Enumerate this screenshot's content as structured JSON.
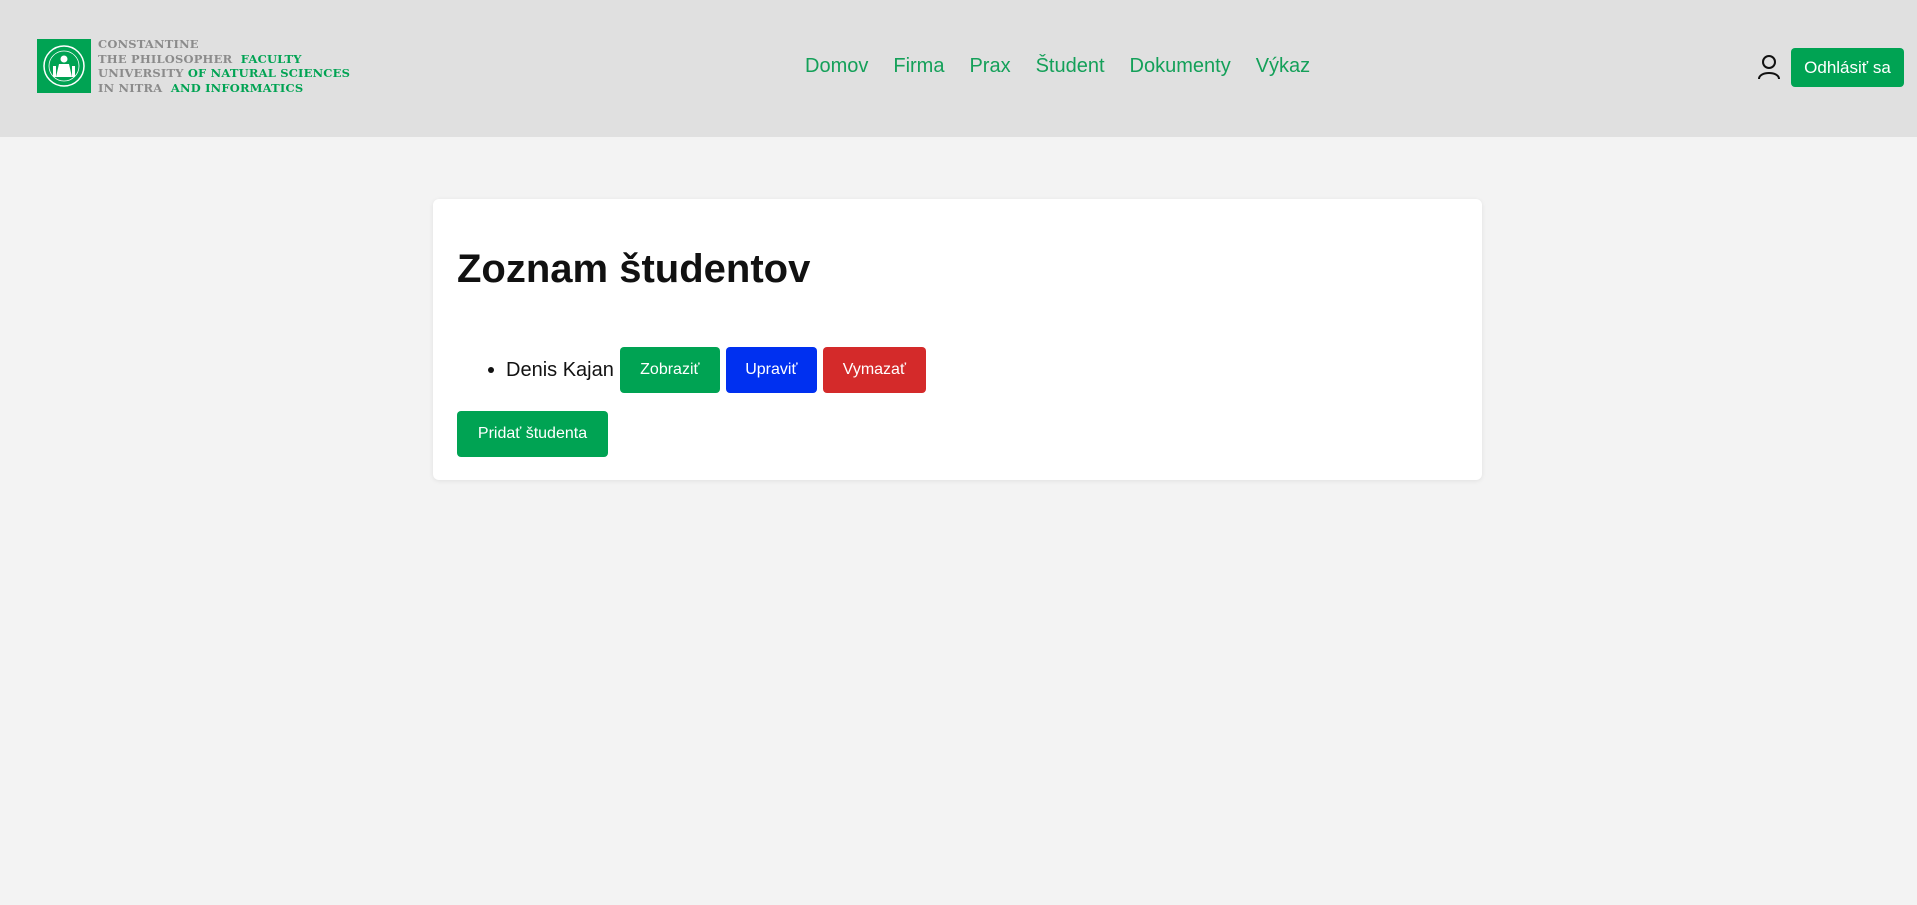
{
  "logo": {
    "university_lines": [
      "CONSTANTINE",
      "THE PHILOSOPHER",
      "UNIVERSITY",
      "IN NITRA"
    ],
    "faculty_lines": [
      "",
      "FACULTY",
      "OF NATURAL SCIENCES",
      "AND INFORMATICS"
    ]
  },
  "nav": {
    "items": [
      "Domov",
      "Firma",
      "Prax",
      "Študent",
      "Dokumenty",
      "Výkaz"
    ]
  },
  "header": {
    "user_icon": "user-icon",
    "logout_label": "Odhlásiť sa"
  },
  "main": {
    "title": "Zoznam študentov",
    "students": [
      {
        "name": "Denis Kajan",
        "show_label": "Zobraziť",
        "edit_label": "Upraviť",
        "delete_label": "Vymazať"
      }
    ],
    "add_label": "Pridať študenta"
  },
  "colors": {
    "brand_green": "#00a353",
    "nav_green": "#14a059",
    "edit_blue": "#0030f0",
    "delete_red": "#d42a2a",
    "header_bg": "#e0e0e0",
    "page_bg": "#f3f3f3"
  }
}
